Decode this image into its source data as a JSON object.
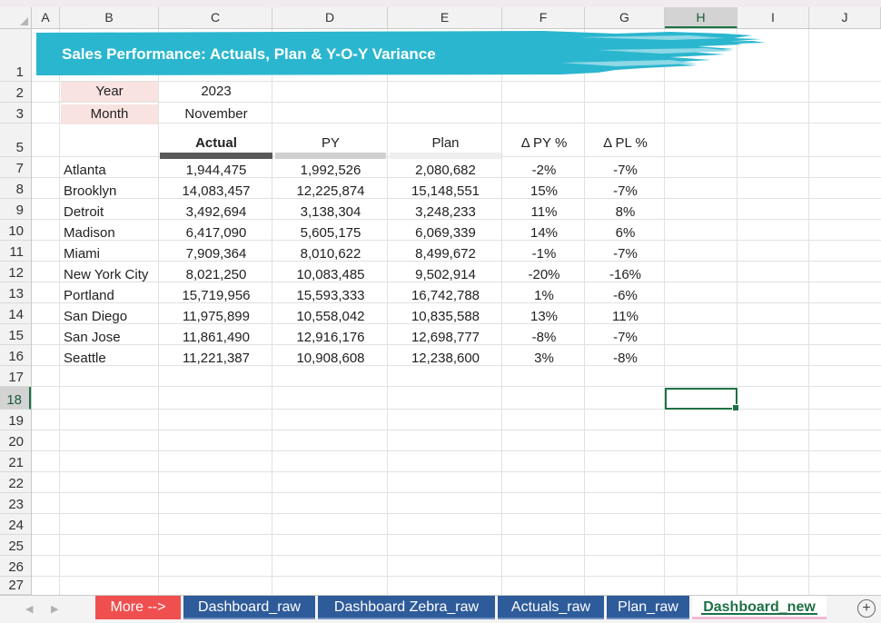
{
  "columns": [
    "A",
    "B",
    "C",
    "D",
    "E",
    "F",
    "G",
    "H",
    "I",
    "J"
  ],
  "selected_column": "H",
  "rows": [
    "1",
    "2",
    "3",
    "5",
    "7",
    "8",
    "9",
    "10",
    "11",
    "12",
    "13",
    "14",
    "15",
    "16",
    "17",
    "18",
    "19",
    "20",
    "21",
    "22",
    "23",
    "24",
    "25",
    "26",
    "27"
  ],
  "selected_row": "18",
  "title": "Sales Performance: Actuals, Plan & Y-O-Y Variance",
  "colors": {
    "brush": "#2bb6cf",
    "brush_light": "#8fd8e6",
    "label_bg": "#f8e3e1",
    "actual_bar": "#595959",
    "py_bar": "#d0d0d0",
    "plan_bar": "#efefef",
    "tab_blue": "#2e5b9a",
    "tab_red": "#f04f4f",
    "excel_green": "#1e7145"
  },
  "filters": {
    "year_label": "Year",
    "year_value": "2023",
    "month_label": "Month",
    "month_value": "November"
  },
  "table": {
    "headers": {
      "actual": "Actual",
      "py": "PY",
      "plan": "Plan",
      "dpy": "Δ PY %",
      "dpl": "Δ PL %"
    },
    "rows": [
      {
        "city": "Atlanta",
        "actual": "1,944,475",
        "py": "1,992,526",
        "plan": "2,080,682",
        "dpy": "-2%",
        "dpl": "-7%"
      },
      {
        "city": "Brooklyn",
        "actual": "14,083,457",
        "py": "12,225,874",
        "plan": "15,148,551",
        "dpy": "15%",
        "dpl": "-7%"
      },
      {
        "city": "Detroit",
        "actual": "3,492,694",
        "py": "3,138,304",
        "plan": "3,248,233",
        "dpy": "11%",
        "dpl": "8%"
      },
      {
        "city": "Madison",
        "actual": "6,417,090",
        "py": "5,605,175",
        "plan": "6,069,339",
        "dpy": "14%",
        "dpl": "6%"
      },
      {
        "city": "Miami",
        "actual": "7,909,364",
        "py": "8,010,622",
        "plan": "8,499,672",
        "dpy": "-1%",
        "dpl": "-7%"
      },
      {
        "city": "New York City",
        "actual": "8,021,250",
        "py": "10,083,485",
        "plan": "9,502,914",
        "dpy": "-20%",
        "dpl": "-16%"
      },
      {
        "city": "Portland",
        "actual": "15,719,956",
        "py": "15,593,333",
        "plan": "16,742,788",
        "dpy": "1%",
        "dpl": "-6%"
      },
      {
        "city": "San Diego",
        "actual": "11,975,899",
        "py": "10,558,042",
        "plan": "10,835,588",
        "dpy": "13%",
        "dpl": "11%"
      },
      {
        "city": "San Jose",
        "actual": "11,861,490",
        "py": "12,916,176",
        "plan": "12,698,777",
        "dpy": "-8%",
        "dpl": "-7%"
      },
      {
        "city": "Seattle",
        "actual": "11,221,387",
        "py": "10,908,608",
        "plan": "12,238,600",
        "dpy": "3%",
        "dpl": "-8%"
      }
    ]
  },
  "sheet_tabs": [
    {
      "label": "More -->",
      "style": "red"
    },
    {
      "label": "Dashboard_raw",
      "style": "blue"
    },
    {
      "label": "Dashboard Zebra_raw",
      "style": "blue"
    },
    {
      "label": "Actuals_raw",
      "style": "blue"
    },
    {
      "label": "Plan_raw",
      "style": "blue"
    },
    {
      "label": "Dashboard_new",
      "style": "active"
    }
  ],
  "icons": {
    "prev_sheet": "chevron-left-icon",
    "next_sheet": "chevron-right-icon",
    "add_sheet": "plus-circle-icon"
  },
  "nav": {
    "prev": "◀",
    "next": "▶",
    "add": "+"
  }
}
